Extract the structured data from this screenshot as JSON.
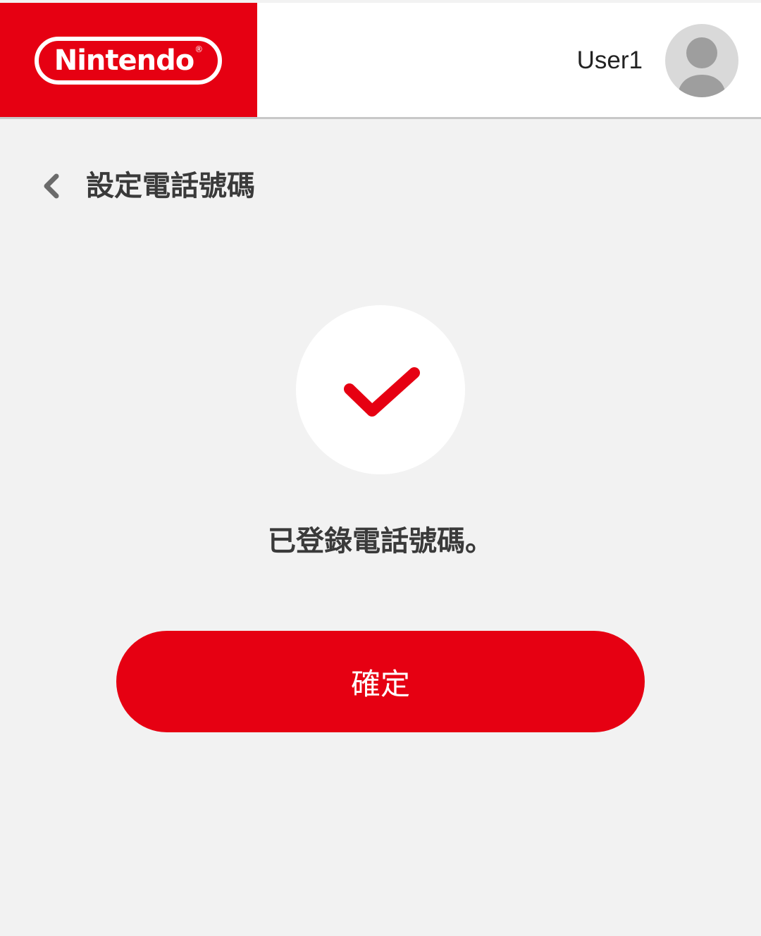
{
  "header": {
    "logo_text": "Nintendo",
    "logo_mark": "®",
    "username": "User1",
    "avatar_icon": "user-avatar-icon"
  },
  "nav": {
    "back_icon": "chevron-left-icon",
    "title": "設定電話號碼"
  },
  "main": {
    "status_icon": "checkmark-icon",
    "message": "已登錄電話號碼。",
    "confirm_label": "確定"
  },
  "colors": {
    "brand_red": "#e60012",
    "background": "#f2f2f2",
    "text": "#3a3a3a",
    "avatar_bg": "#d9d9d9",
    "avatar_fg": "#9e9e9e"
  }
}
